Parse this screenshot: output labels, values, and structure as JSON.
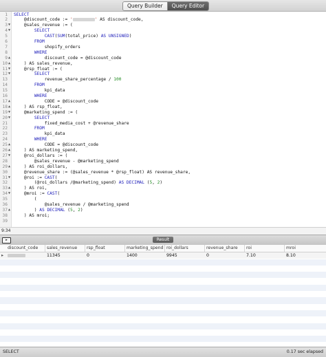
{
  "toolbar": {
    "tabs": [
      {
        "label": "Query Builder",
        "active": false
      },
      {
        "label": "Query Editor",
        "active": true
      }
    ]
  },
  "editor": {
    "lines": [
      {
        "n": "1",
        "fold": "",
        "code": "<span class='kw'>SELECT</span>"
      },
      {
        "n": "2",
        "fold": "",
        "code": "    @discount_code := <span class='str'>'</span><span class='redacted'></span><span class='str'>'</span> AS discount_code,"
      },
      {
        "n": "3",
        "fold": "▼",
        "code": "    @sales_revenue := ("
      },
      {
        "n": "4",
        "fold": "▼",
        "code": "        <span class='kw'>SELECT</span>"
      },
      {
        "n": "5",
        "fold": "",
        "code": "            <span class='kw'>CAST</span>(<span class='kw'>SUM</span>(total_price) <span class='kw'>AS</span> <span class='kw'>UNSIGNED</span>)"
      },
      {
        "n": "6",
        "fold": "",
        "code": "        <span class='kw'>FROM</span>"
      },
      {
        "n": "7",
        "fold": "",
        "code": "            shopify_orders"
      },
      {
        "n": "8",
        "fold": "",
        "code": "        <span class='kw'>WHERE</span>"
      },
      {
        "n": "9",
        "fold": "▲",
        "code": "            discount_code = @discount_code"
      },
      {
        "n": "10",
        "fold": "▲",
        "code": "    ) AS sales_revenue,"
      },
      {
        "n": "11",
        "fold": "▼",
        "code": "    @rsp_float := ("
      },
      {
        "n": "12",
        "fold": "▼",
        "code": "        <span class='kw'>SELECT</span>"
      },
      {
        "n": "13",
        "fold": "",
        "code": "            revenue_share_percentage / <span class='num'>100</span>"
      },
      {
        "n": "14",
        "fold": "",
        "code": "        <span class='kw'>FROM</span>"
      },
      {
        "n": "15",
        "fold": "",
        "code": "            kpi_data"
      },
      {
        "n": "16",
        "fold": "",
        "code": "        <span class='kw'>WHERE</span>"
      },
      {
        "n": "17",
        "fold": "▲",
        "code": "            CODE = @discount_code"
      },
      {
        "n": "18",
        "fold": "▲",
        "code": "    ) AS rsp_float,"
      },
      {
        "n": "19",
        "fold": "▼",
        "code": "    @marketing_spend := ("
      },
      {
        "n": "20",
        "fold": "▼",
        "code": "        <span class='kw'>SELECT</span>"
      },
      {
        "n": "21",
        "fold": "",
        "code": "            fixed_media_cost + @revenue_share"
      },
      {
        "n": "22",
        "fold": "",
        "code": "        <span class='kw'>FROM</span>"
      },
      {
        "n": "23",
        "fold": "",
        "code": "            kpi_data"
      },
      {
        "n": "24",
        "fold": "",
        "code": "        <span class='kw'>WHERE</span>"
      },
      {
        "n": "25",
        "fold": "▲",
        "code": "            CODE = @discount_code"
      },
      {
        "n": "26",
        "fold": "▲",
        "code": "    ) AS marketing_spend,"
      },
      {
        "n": "27",
        "fold": "▼",
        "code": "    @roi_dollars := ("
      },
      {
        "n": "28",
        "fold": "",
        "code": "        @sales_revenue - @marketing_spend"
      },
      {
        "n": "29",
        "fold": "▲",
        "code": "    ) AS roi_dollars,"
      },
      {
        "n": "30",
        "fold": "",
        "code": "    @revenue_share := (@sales_revenue * @rsp_float) AS revenue_share,"
      },
      {
        "n": "31",
        "fold": "▼",
        "code": "    @roi := <span class='kw'>CAST</span>("
      },
      {
        "n": "32",
        "fold": "",
        "code": "        (@roi_dollars /@marketing_spend) <span class='kw'>AS</span> <span class='kw'>DECIMAL</span> (<span class='num'>5</span>, <span class='num'>2</span>)"
      },
      {
        "n": "33",
        "fold": "▲",
        "code": "    ) AS roi,"
      },
      {
        "n": "34",
        "fold": "▼",
        "code": "    @mroi := <span class='kw'>CAST</span>("
      },
      {
        "n": "35",
        "fold": "",
        "code": "        ("
      },
      {
        "n": "36",
        "fold": "",
        "code": "            @sales_revenue / @marketing_spend"
      },
      {
        "n": "37",
        "fold": "▲",
        "code": "        ) <span class='kw'>AS</span> <span class='kw'>DECIMAL</span> (<span class='num'>5</span>, <span class='num'>2</span>)"
      },
      {
        "n": "38",
        "fold": "",
        "code": "    ) AS mroi;"
      },
      {
        "n": "39",
        "fold": "",
        "code": ""
      }
    ]
  },
  "cursor_position": "9:34",
  "result": {
    "tab_label": "Result",
    "columns": [
      "discount_code",
      "sales_revenue",
      "rsp_float",
      "marketing_spend",
      "roi_dollars",
      "revenue_share",
      "roi",
      "mroi"
    ],
    "rows": [
      [
        "",
        "11345",
        "0",
        "1400",
        "9945",
        "0",
        "7.10",
        "8.10"
      ]
    ]
  },
  "footer": {
    "status_left": "SELECT",
    "status_right": "0.17 sec elapsed"
  }
}
